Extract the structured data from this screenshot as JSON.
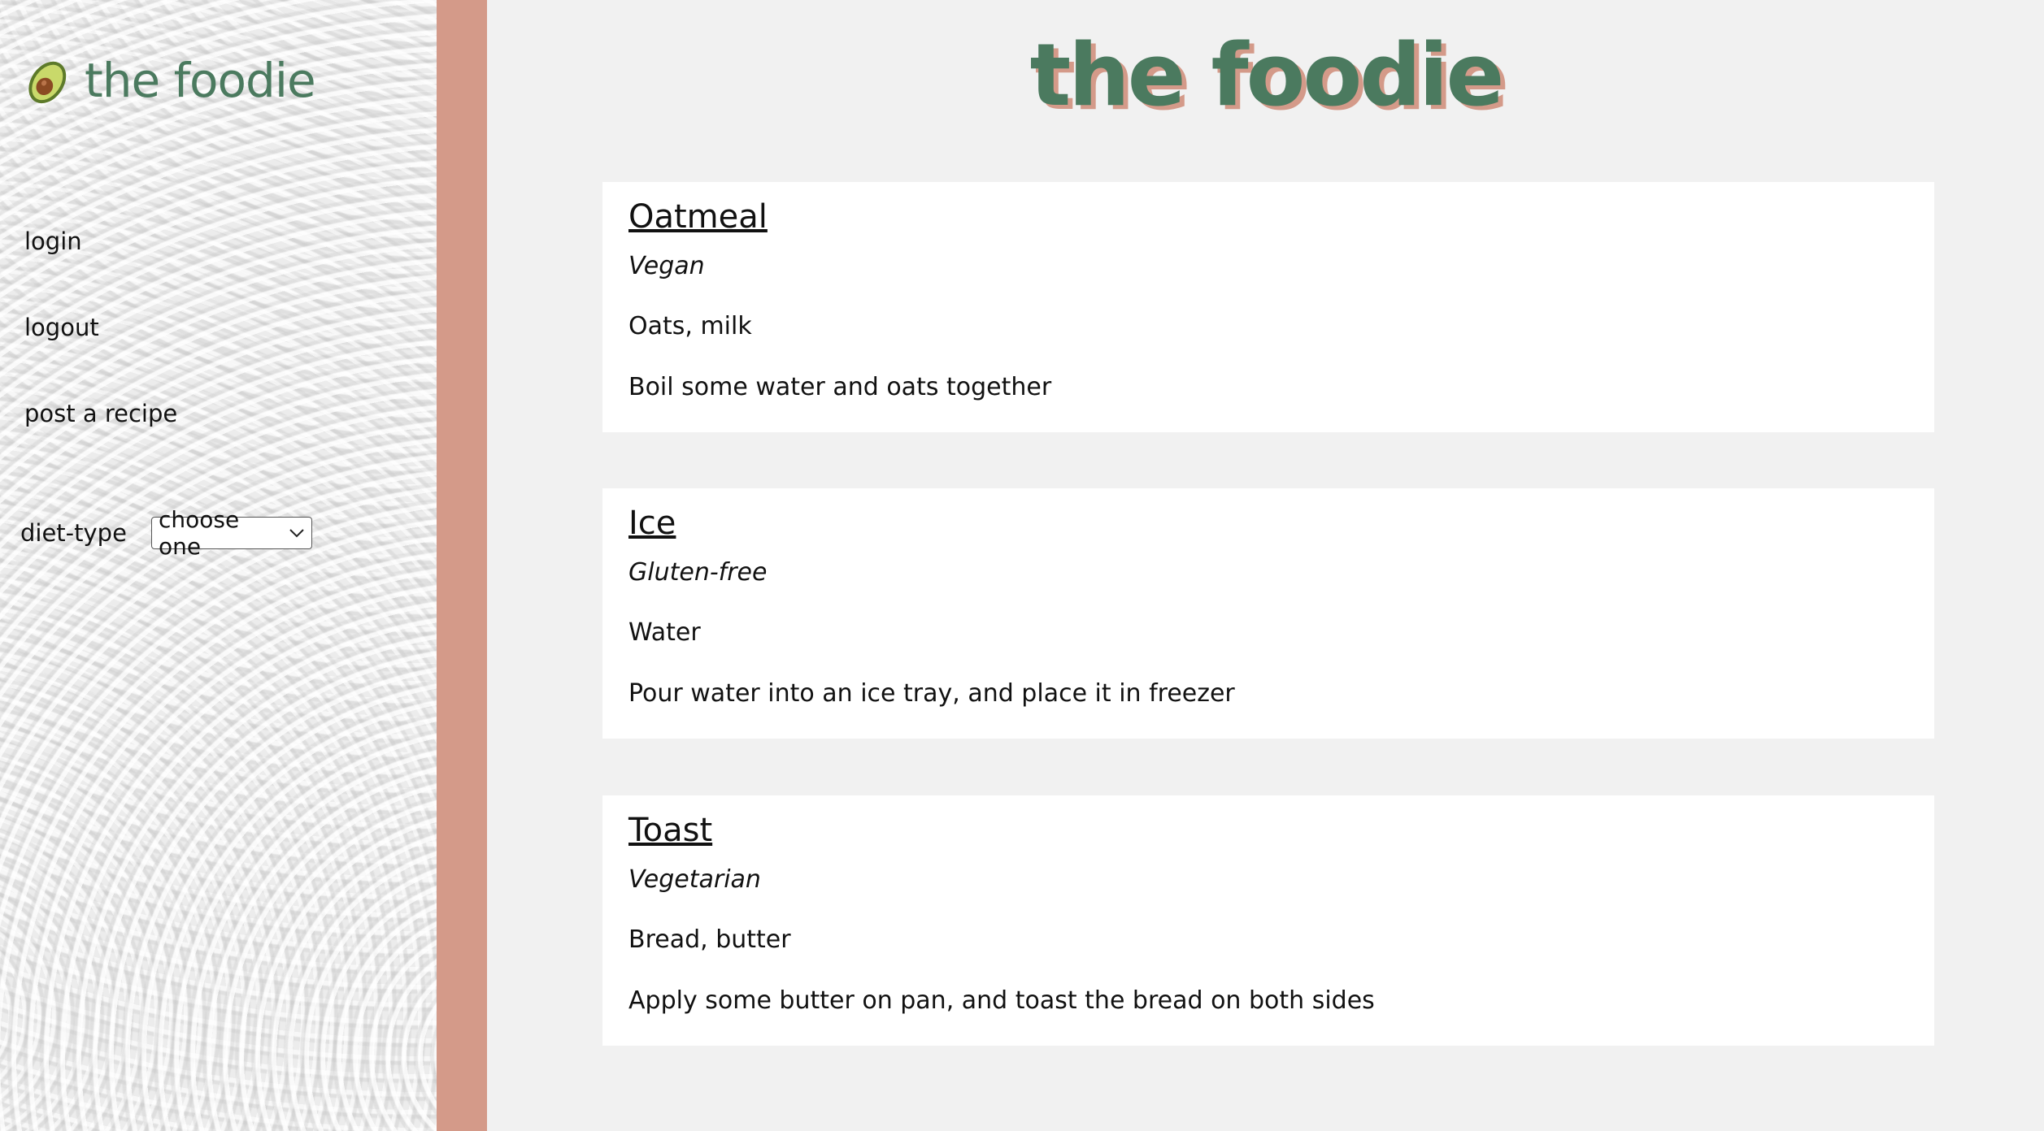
{
  "sidebar": {
    "brand": "the foodie",
    "brand_icon": "avocado-icon",
    "nav": {
      "login": "login",
      "logout": "logout",
      "post": "post a recipe"
    },
    "filter": {
      "label": "diet-type",
      "selected": "choose one"
    }
  },
  "header": {
    "title": "the foodie"
  },
  "colors": {
    "brand_green": "#4b7a5f",
    "accent_salmon": "#d49a89",
    "page_bg": "#f1f1f1"
  },
  "recipes": [
    {
      "name": "Oatmeal",
      "diet": "Vegan",
      "ingredients": "Oats, milk",
      "instructions": "Boil some water and oats together"
    },
    {
      "name": "Ice",
      "diet": "Gluten-free",
      "ingredients": "Water",
      "instructions": "Pour water into an ice tray, and place it in freezer"
    },
    {
      "name": "Toast",
      "diet": "Vegetarian",
      "ingredients": "Bread, butter",
      "instructions": "Apply some butter on pan, and toast the bread on both sides"
    }
  ]
}
